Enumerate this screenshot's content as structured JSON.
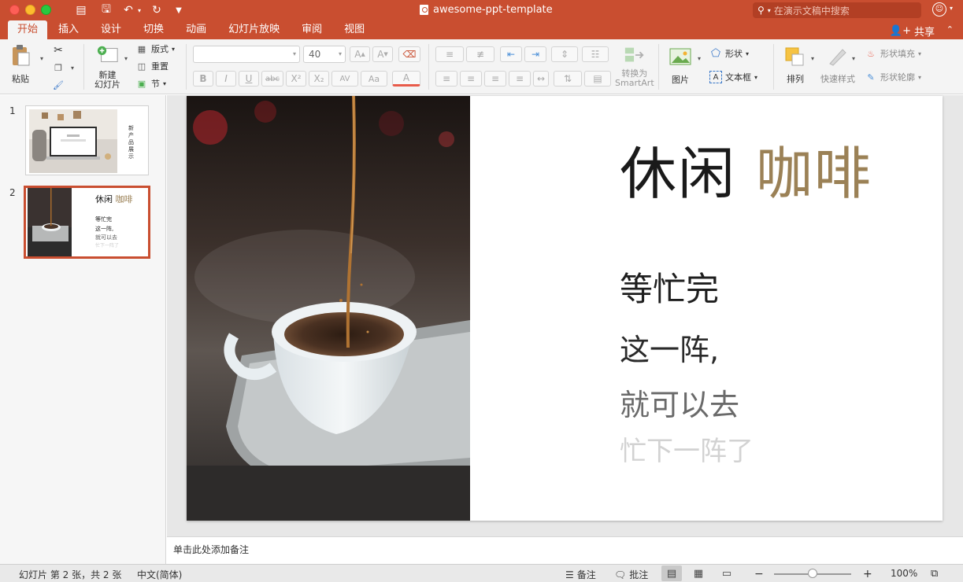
{
  "window": {
    "title": "awesome-ppt-template",
    "search_placeholder": "在演示文稿中搜索"
  },
  "tabs": [
    "开始",
    "插入",
    "设计",
    "切换",
    "动画",
    "幻灯片放映",
    "审阅",
    "视图"
  ],
  "active_tab": "开始",
  "share_label": "共享",
  "ribbon": {
    "paste": "粘贴",
    "new_slide": "新建\n幻灯片",
    "new_slide_line1": "新建",
    "new_slide_line2": "幻灯片",
    "layout": "版式",
    "reset": "重置",
    "section": "节",
    "font_name": "",
    "font_size": "40",
    "convert_smartart_line1": "转换为",
    "convert_smartart_line2": "SmartArt",
    "picture": "图片",
    "shape": "形状",
    "textbox": "文本框",
    "arrange": "排列",
    "quick_styles": "快速样式",
    "shape_fill": "形状填充",
    "shape_outline": "形状轮廓",
    "bold": "B",
    "italic": "I",
    "underline": "U",
    "strike": "abc",
    "superscript": "X²",
    "subscript": "X₂",
    "char_spacing": "AV",
    "change_case": "Aa",
    "font_color": "A"
  },
  "thumbnails": [
    {
      "number": "1",
      "vertical_text": "新产品展示"
    },
    {
      "number": "2",
      "title": "休闲",
      "title_accent": "咖啡",
      "l1": "等忙完",
      "l2": "这一阵,",
      "l3": "就可以去",
      "l4": "忙下一阵了"
    }
  ],
  "slide": {
    "title": "休闲",
    "title_accent": "咖啡",
    "line1": "等忙完",
    "line2": "这一阵,",
    "line3": "就可以去",
    "line4": "忙下一阵了"
  },
  "notes_placeholder": "单击此处添加备注",
  "status": {
    "slide_info": "幻灯片 第 2 张，共 2 张",
    "language": "中文(简体)",
    "notes": "备注",
    "comments": "批注",
    "zoom": "100%"
  },
  "colors": {
    "accent": "#c94e30",
    "coffee_gold": "#9b8156"
  }
}
